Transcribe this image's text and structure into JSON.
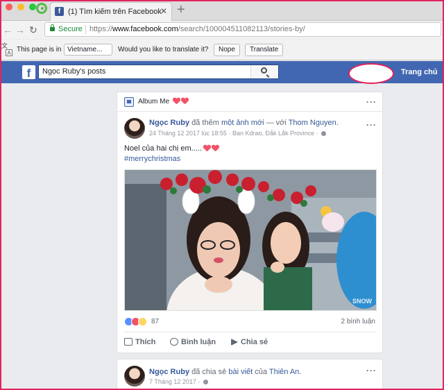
{
  "browser": {
    "tab_title": "(1) Tìm kiếm trên Facebook",
    "tab_close": "✕",
    "new_tab": "+",
    "secure_label": "Secure",
    "url_scheme": "https://",
    "url_domain": "www.facebook.com",
    "url_path": "/search/100004511082113/stories-by/"
  },
  "translate": {
    "prefix": "This page is in",
    "language": "Vietname...",
    "question": "Would you like to translate it?",
    "nope": "Nope",
    "translate": "Translate"
  },
  "facebook": {
    "logo": "f",
    "search_value": "Ngọc Ruby's posts",
    "home": "Trang chủ"
  },
  "post1": {
    "album_title": "Album Me",
    "author": "Ngọc Ruby",
    "verb": "đã thêm",
    "object": "một ảnh mới",
    "with": "— với",
    "tagged": "Thom Nguyen.",
    "date": "24 Tháng 12 2017 lúc 18:55",
    "location": "· Ban Kdrao, Đắk Lắk Province ·",
    "caption": "Noel của hai chị em.....",
    "hashtag": "#merrychristmas",
    "watermark": "SNOW",
    "reaction_count": "87",
    "comments": "2 bình luận",
    "like": "Thích",
    "comment": "Bình luận",
    "share": "Chia sẻ"
  },
  "post2": {
    "author": "Ngọc Ruby",
    "verb": "đã chia sẻ",
    "object": "bài viết",
    "of": "của",
    "target": "Thiên An.",
    "date": "7 Tháng 12 2017 ·"
  },
  "colors": {
    "facebook_blue": "#4267b2",
    "link_blue": "#365899",
    "highlight_frame": "#e0245e"
  }
}
